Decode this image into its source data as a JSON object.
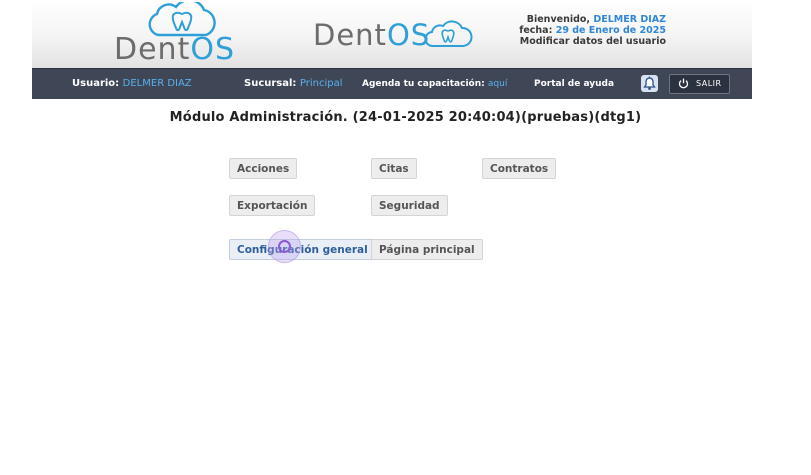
{
  "header": {
    "logo_primary": {
      "part1": "Dent",
      "part2": "OS"
    },
    "logo_secondary": {
      "part1": "Dent",
      "part2": "OS"
    },
    "welcome_label": "Bienvenido,",
    "welcome_user": "DELMER DIAZ",
    "date_label": "fecha:",
    "date_value": "29 de Enero de 2025",
    "modify_link": "Modificar datos del usuario"
  },
  "navbar": {
    "user_label": "Usuario:",
    "user_value": "DELMER DIAZ",
    "branch_label": "Sucursal:",
    "branch_value": "Principal",
    "training_label": "Agenda tu capacitación:",
    "training_link": "aquí",
    "help_portal": "Portal de ayuda",
    "bell_icon": "bell-icon",
    "logout_label": "SALIR",
    "logout_icon": "power-icon"
  },
  "page": {
    "title": "Módulo Administración. (24-01-2025 20:40:04)(pruebas)(dtg1)"
  },
  "modules": [
    {
      "label": "Acciones"
    },
    {
      "label": "Citas"
    },
    {
      "label": "Contratos"
    },
    {
      "label": "Exportación"
    },
    {
      "label": "Seguridad"
    },
    {
      "label": "Configuración general"
    },
    {
      "label": "Página principal"
    }
  ],
  "colors": {
    "accent_blue": "#2f9fd8",
    "navbar_bg": "#3f4756",
    "link_blue": "#59b0ef"
  }
}
